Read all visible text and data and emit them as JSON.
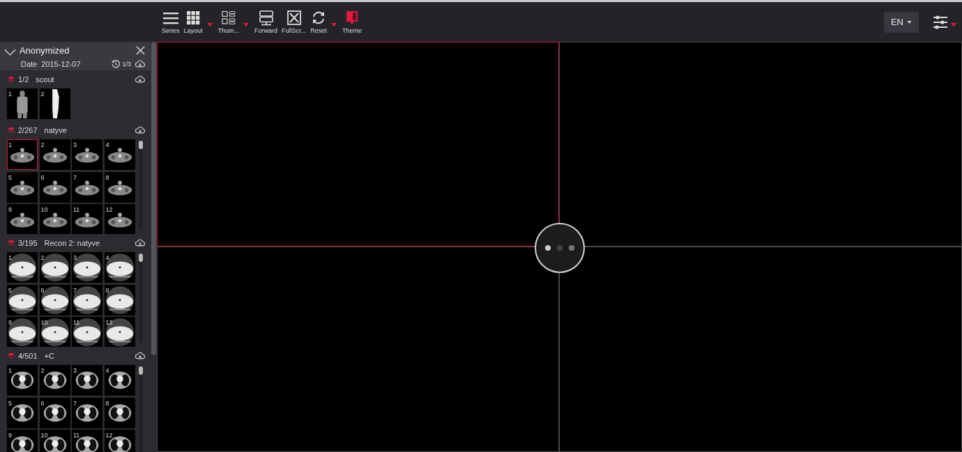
{
  "toolbar": {
    "buttons": [
      {
        "label": "Series",
        "dropdown": false
      },
      {
        "label": "Layout",
        "dropdown": true
      },
      {
        "label": "Thum...",
        "dropdown": true
      },
      {
        "label": "Forward",
        "dropdown": false
      },
      {
        "label": "FullScr...",
        "dropdown": false
      },
      {
        "label": "Reset",
        "dropdown": true
      },
      {
        "label": "Theme",
        "dropdown": false
      }
    ]
  },
  "language": {
    "label": "EN"
  },
  "settings": {
    "dropdown": true
  },
  "study": {
    "name": "Anonymized",
    "expanded": true,
    "date_label": "Date",
    "date": "2015-12-07",
    "history": "1/3"
  },
  "series": [
    {
      "count": "1/2",
      "name": "scout",
      "kind": "scout",
      "scrollable": false,
      "thumbnails": [
        {
          "number": "1",
          "selected": false
        },
        {
          "number": "2",
          "selected": false
        }
      ]
    },
    {
      "count": "2/267",
      "name": "natyve",
      "kind": "neck",
      "scrollable": true,
      "thumbnails": [
        {
          "number": "1",
          "selected": true
        },
        {
          "number": "2",
          "selected": false
        },
        {
          "number": "3",
          "selected": false
        },
        {
          "number": "4",
          "selected": false
        },
        {
          "number": "5",
          "selected": false
        },
        {
          "number": "6",
          "selected": false
        },
        {
          "number": "7",
          "selected": false
        },
        {
          "number": "8",
          "selected": false
        },
        {
          "number": "9",
          "selected": false
        },
        {
          "number": "10",
          "selected": false
        },
        {
          "number": "11",
          "selected": false
        },
        {
          "number": "12",
          "selected": false
        }
      ]
    },
    {
      "count": "3/195",
      "name": "Recon 2: natyve",
      "kind": "bright",
      "scrollable": true,
      "thumbnails": [
        {
          "number": "1",
          "selected": false
        },
        {
          "number": "2",
          "selected": false
        },
        {
          "number": "3",
          "selected": false
        },
        {
          "number": "4",
          "selected": false
        },
        {
          "number": "5",
          "selected": false
        },
        {
          "number": "6",
          "selected": false
        },
        {
          "number": "7",
          "selected": false
        },
        {
          "number": "8",
          "selected": false
        },
        {
          "number": "9",
          "selected": false
        },
        {
          "number": "10",
          "selected": false
        },
        {
          "number": "11",
          "selected": false
        },
        {
          "number": "12",
          "selected": false
        }
      ]
    },
    {
      "count": "4/501",
      "name": "+C",
      "kind": "lung",
      "scrollable": true,
      "thumbnails": [
        {
          "number": "1",
          "selected": false
        },
        {
          "number": "2",
          "selected": false
        },
        {
          "number": "3",
          "selected": false
        },
        {
          "number": "4",
          "selected": false
        },
        {
          "number": "5",
          "selected": false
        },
        {
          "number": "6",
          "selected": false
        },
        {
          "number": "7",
          "selected": false
        },
        {
          "number": "8",
          "selected": false
        },
        {
          "number": "9",
          "selected": false
        },
        {
          "number": "10",
          "selected": false
        },
        {
          "number": "11",
          "selected": false
        },
        {
          "number": "12",
          "selected": false
        }
      ]
    }
  ],
  "viewer": {
    "loading": true,
    "panes": [
      {
        "selected": true
      },
      {
        "selected": false
      },
      {
        "selected": false
      },
      {
        "selected": false
      }
    ]
  }
}
